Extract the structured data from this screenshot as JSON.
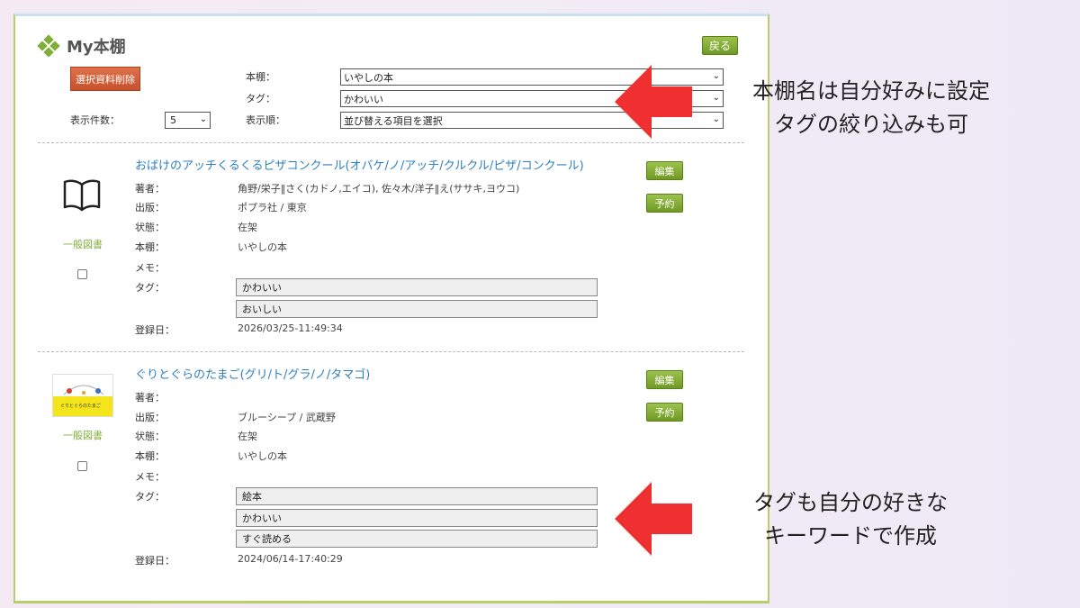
{
  "page": {
    "title": "My本棚",
    "back_label": "戻る",
    "delete_selected_label": "選択資料削除"
  },
  "filters": {
    "shelf_label": "本棚：",
    "shelf_value": "いやしの本",
    "tag_label": "タグ：",
    "tag_value": "かわいい",
    "count_label": "表示件数：",
    "count_value": "5",
    "order_label": "表示順：",
    "order_value": "並び替える項目を選択"
  },
  "field_labels": {
    "author": "著者：",
    "publisher": "出版：",
    "status": "状態：",
    "shelf": "本棚：",
    "memo": "メモ：",
    "tags": "タグ：",
    "registered": "登録日："
  },
  "records": [
    {
      "title": "おばけのアッチくるくるピザコンクール(オバケ/ノ/アッチ/クルクル/ピザ/コンクール)",
      "category": "一般図書",
      "author": "角野/栄子‖さく(カドノ,エイコ), 佐々木/洋子‖え(ササキ,ヨウコ)",
      "publisher": "ポプラ社 / 東京",
      "status": "在架",
      "shelf": "いやしの本",
      "memo": "",
      "tags": [
        "かわいい",
        "おいしい"
      ],
      "registered": "2026/03/25-11:49:34",
      "edit_label": "編集",
      "reserve_label": "予約",
      "icon": "open-book-icon"
    },
    {
      "title": "ぐりとぐらのたまご(グリ/ト/グラ/ノ/タマゴ)",
      "category": "一般図書",
      "author": "",
      "publisher": "ブルーシープ / 武蔵野",
      "status": "在架",
      "shelf": "いやしの本",
      "memo": "",
      "tags": [
        "絵本",
        "かわいい",
        "すぐ読める"
      ],
      "registered": "2024/06/14-17:40:29",
      "edit_label": "編集",
      "reserve_label": "予約",
      "cover_text": "ぐりとぐらのたまご"
    }
  ],
  "annotations": {
    "top_line1": "本棚名は自分好みに設定",
    "top_line2": "タグの絞り込みも可",
    "bottom_line1": "タグも自分の好きな",
    "bottom_line2": "キーワードで作成"
  },
  "colors": {
    "accent_green": "#7fae3a",
    "link_blue": "#2e7fc1",
    "delete_red": "#c7512c",
    "arrow_red": "#f03030"
  }
}
